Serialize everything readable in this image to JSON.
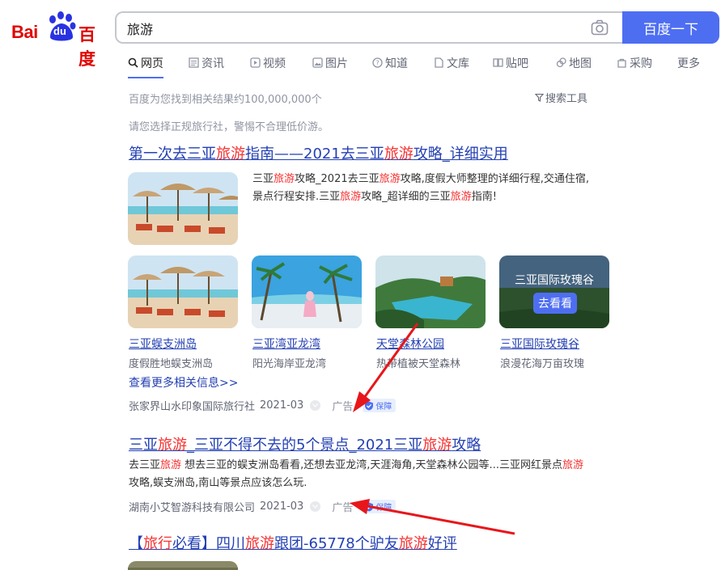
{
  "header": {
    "logo_bai": "Bai",
    "logo_du": "du",
    "logo_cn": "百度",
    "search_value": "旅游",
    "search_button": "百度一下"
  },
  "tabs": [
    {
      "label": "网页",
      "icon": "search-icon",
      "active": true
    },
    {
      "label": "资讯",
      "icon": "news-icon"
    },
    {
      "label": "视频",
      "icon": "video-icon"
    },
    {
      "label": "图片",
      "icon": "image-icon"
    },
    {
      "label": "知道",
      "icon": "question-icon"
    },
    {
      "label": "文库",
      "icon": "doc-icon"
    },
    {
      "label": "贴吧",
      "icon": "tieba-icon"
    },
    {
      "label": "地图",
      "icon": "map-icon"
    },
    {
      "label": "采购",
      "icon": "shop-icon"
    },
    {
      "label": "更多"
    }
  ],
  "result_count": "百度为您找到相关结果约100,000,000个",
  "search_tools": "搜索工具",
  "notice": "请您选择正规旅行社，警惕不合理低价游。",
  "results": [
    {
      "title_parts": [
        "第一次去三亚",
        "旅游",
        "指南——2021去三亚",
        "旅游",
        "攻略_详细实用"
      ],
      "abstract_line1_parts": [
        "三亚",
        "旅游",
        "攻略_2021去三亚",
        "旅游",
        "攻略,度假大师整理的详细行程,交通住宿,"
      ],
      "abstract_line2_parts": [
        "景点行程安排.三亚",
        "旅游",
        "攻略_超详细的三亚",
        "旅游",
        "指南!"
      ],
      "cards": [
        {
          "title": "三亚蜈支洲岛",
          "sub": "度假胜地蜈支洲岛"
        },
        {
          "title": "三亚湾亚龙湾",
          "sub": "阳光海岸亚龙湾"
        },
        {
          "title": "天堂森林公园",
          "sub": "热带植被天堂森林"
        },
        {
          "title": "三亚国际玫瑰谷",
          "sub": "浪漫花海万亩玫瑰",
          "overlay": "三亚国际玫瑰谷",
          "button": "去看看"
        }
      ],
      "more": "查看更多相关信息>>",
      "source": "张家界山水印象国际旅行社",
      "date": "2021-03",
      "ad": "广告",
      "badge": "保障"
    },
    {
      "title_parts": [
        "三亚",
        "旅游",
        "_三亚不得不去的5个景点_2021三亚",
        "旅游",
        "攻略"
      ],
      "abstract_line1_parts": [
        "去三亚",
        "旅游",
        " 想去三亚的蜈支洲岛看看,还想去亚龙湾,天涯海角,天堂森林公园等...三亚网红景点",
        "旅游"
      ],
      "abstract_line2": "攻略,蜈支洲岛,南山等景点应该怎么玩.",
      "source": "湖南小艾智游科技有限公司",
      "date": "2021-03",
      "ad": "广告",
      "badge": "保障"
    },
    {
      "title_parts": [
        "【",
        "旅行",
        "必看】四川",
        "旅游",
        "跟团-65778个驴友",
        "旅游",
        "好评"
      ]
    }
  ],
  "colors": {
    "accent": "#4e6ef2",
    "link": "#2440b3",
    "highlight": "#f73131",
    "annotation_arrow": "#e8161b"
  }
}
